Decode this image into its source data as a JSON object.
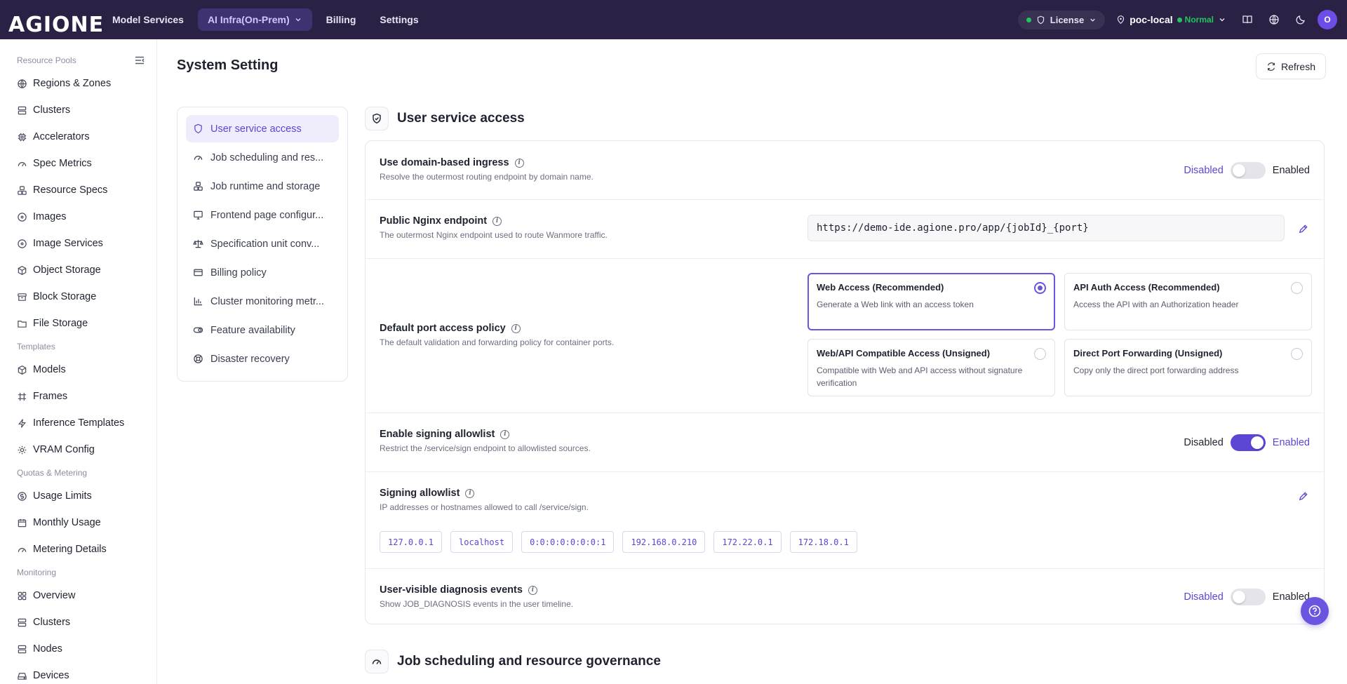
{
  "brand": {
    "logo_text": "AGIONE"
  },
  "topnav": {
    "items": [
      {
        "label": "Model Services"
      },
      {
        "label": "AI Infra(On-Prem)"
      },
      {
        "label": "Billing"
      },
      {
        "label": "Settings"
      }
    ],
    "license_label": "License",
    "env_name": "poc-local",
    "env_status": "Normal",
    "avatar_initial": "O",
    "colors": {
      "bar": "#2b2145",
      "active": "#3e3370",
      "status": "#22c55e"
    }
  },
  "sidebar": {
    "groups": [
      {
        "label": "Resource Pools",
        "items": [
          {
            "label": "Regions & Zones",
            "icon": "globe-icon"
          },
          {
            "label": "Clusters",
            "icon": "server-icon"
          },
          {
            "label": "Accelerators",
            "icon": "chip-icon"
          },
          {
            "label": "Spec Metrics",
            "icon": "gauge-icon"
          },
          {
            "label": "Resource Specs",
            "icon": "boxes-icon"
          },
          {
            "label": "Images",
            "icon": "disc-icon"
          },
          {
            "label": "Image Services",
            "icon": "disc-icon"
          },
          {
            "label": "Object Storage",
            "icon": "cube-icon"
          },
          {
            "label": "Block Storage",
            "icon": "archive-icon"
          },
          {
            "label": "File Storage",
            "icon": "folder-icon"
          }
        ]
      },
      {
        "label": "Templates",
        "items": [
          {
            "label": "Models",
            "icon": "cube-icon"
          },
          {
            "label": "Frames",
            "icon": "frame-icon"
          },
          {
            "label": "Inference Templates",
            "icon": "spark-icon"
          },
          {
            "label": "VRAM Config",
            "icon": "gear-icon"
          }
        ]
      },
      {
        "label": "Quotas & Metering",
        "items": [
          {
            "label": "Usage Limits",
            "icon": "coin-icon"
          },
          {
            "label": "Monthly Usage",
            "icon": "calendar-icon"
          },
          {
            "label": "Metering Details",
            "icon": "gauge-icon"
          }
        ]
      },
      {
        "label": "Monitoring",
        "items": [
          {
            "label": "Overview",
            "icon": "grid-icon"
          },
          {
            "label": "Clusters",
            "icon": "server-icon"
          },
          {
            "label": "Nodes",
            "icon": "server-icon"
          },
          {
            "label": "Devices",
            "icon": "hdd-icon"
          }
        ]
      }
    ]
  },
  "page": {
    "title": "System Setting",
    "refresh_label": "Refresh"
  },
  "subnav": {
    "items": [
      {
        "label": "User service access",
        "icon": "shield-icon"
      },
      {
        "label": "Job scheduling and res...",
        "icon": "gauge-icon"
      },
      {
        "label": "Job runtime and storage",
        "icon": "boxes-icon"
      },
      {
        "label": "Frontend page configur...",
        "icon": "monitor-icon"
      },
      {
        "label": "Specification unit conv...",
        "icon": "scale-icon"
      },
      {
        "label": "Billing policy",
        "icon": "card-icon"
      },
      {
        "label": "Cluster monitoring metr...",
        "icon": "chart-icon"
      },
      {
        "label": "Feature availability",
        "icon": "toggle-icon"
      },
      {
        "label": "Disaster recovery",
        "icon": "lifebuoy-icon"
      }
    ]
  },
  "section_access": {
    "title": "User service access",
    "domain_ingress": {
      "title": "Use domain-based ingress",
      "desc": "Resolve the outermost routing endpoint by domain name.",
      "off_label": "Disabled",
      "on_label": "Enabled",
      "enabled": false
    },
    "nginx": {
      "title": "Public Nginx endpoint",
      "desc": "The outermost Nginx endpoint used to route Wanmore traffic.",
      "value": "https://demo-ide.agione.pro/app/{jobId}_{port}"
    },
    "port_policy": {
      "title": "Default port access policy",
      "desc": "The default validation and forwarding policy for container ports.",
      "options": [
        {
          "title": "Web Access (Recommended)",
          "desc": "Generate a Web link with an access token",
          "selected": true
        },
        {
          "title": "API Auth Access (Recommended)",
          "desc": "Access the API with an Authorization header",
          "selected": false
        },
        {
          "title": "Web/API Compatible Access (Unsigned)",
          "desc": "Compatible with Web and API access without signature verification",
          "selected": false
        },
        {
          "title": "Direct Port Forwarding (Unsigned)",
          "desc": "Copy only the direct port forwarding address",
          "selected": false
        }
      ]
    },
    "signing_toggle": {
      "title": "Enable signing allowlist",
      "desc": "Restrict the /service/sign endpoint to allowlisted sources.",
      "off_label": "Disabled",
      "on_label": "Enabled",
      "enabled": true
    },
    "signing_list": {
      "title": "Signing allowlist",
      "desc": "IP addresses or hostnames allowed to call /service/sign.",
      "entries": [
        "127.0.0.1",
        "localhost",
        "0:0:0:0:0:0:0:1",
        "192.168.0.210",
        "172.22.0.1",
        "172.18.0.1"
      ]
    },
    "diagnosis": {
      "title": "User-visible diagnosis events",
      "desc": "Show JOB_DIAGNOSIS events in the user timeline.",
      "off_label": "Disabled",
      "on_label": "Enabled",
      "enabled": false
    }
  },
  "section_scheduling": {
    "title": "Job scheduling and resource governance"
  },
  "accent_color": "#5b46d6"
}
